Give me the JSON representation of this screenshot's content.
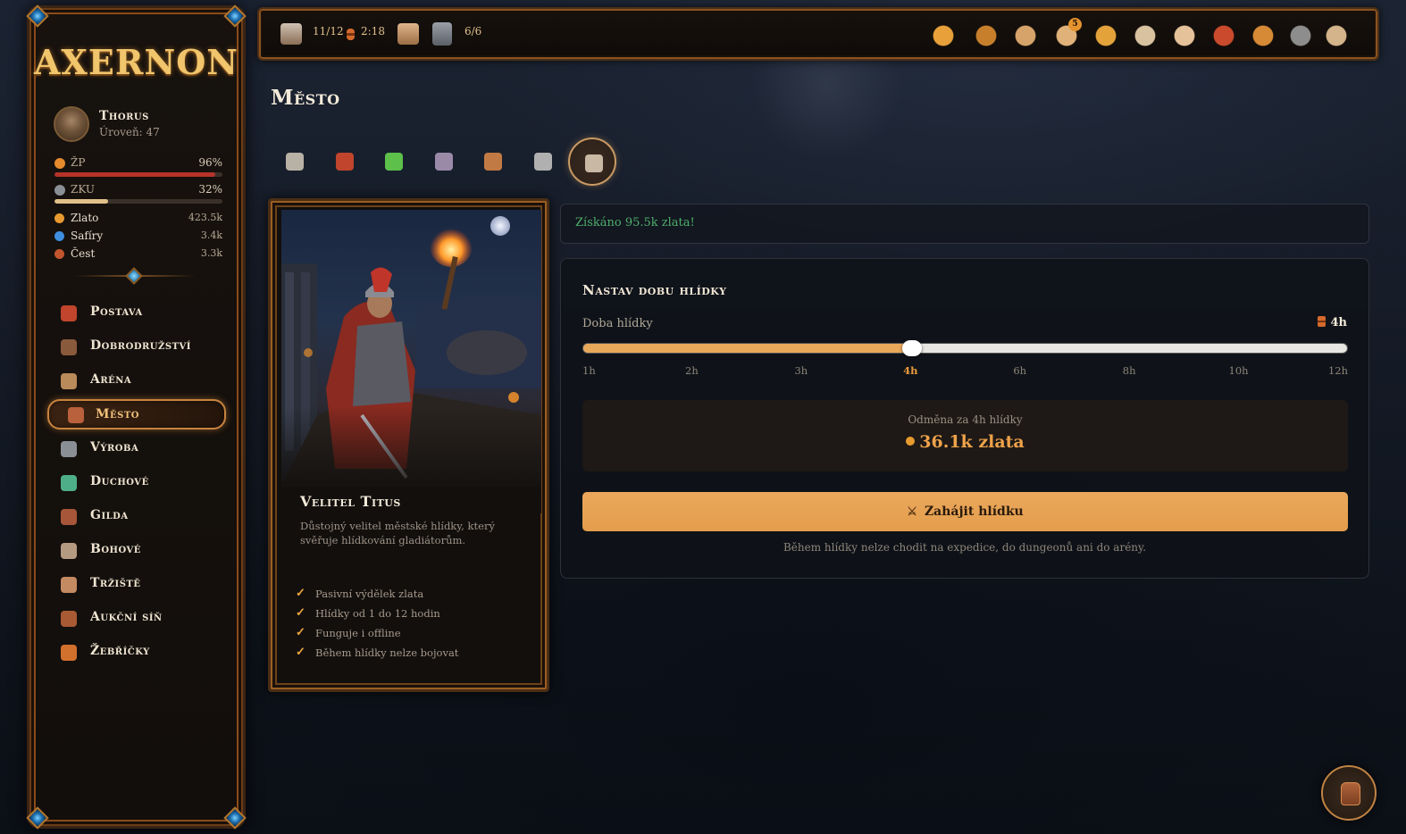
{
  "app": {
    "logo": "AXERNON"
  },
  "player": {
    "name": "Thorus",
    "level_label": "Úroveň: 47"
  },
  "stats": {
    "hp": {
      "label": "ŽP",
      "value": "96%",
      "percent": 96,
      "color": "#b6332a"
    },
    "xp": {
      "label": "ZKU",
      "value": "32%",
      "percent": 32,
      "color": "#e2c08a"
    }
  },
  "resources": [
    {
      "label": "Zlato",
      "value": "423.5k",
      "icon": "gold-coin-icon",
      "color": "#e79a2f"
    },
    {
      "label": "Safíry",
      "value": "3.4k",
      "icon": "sapphire-icon",
      "color": "#3f8ee0"
    },
    {
      "label": "Čest",
      "value": "3.3k",
      "icon": "honor-icon",
      "color": "#c2552d"
    }
  ],
  "nav": [
    {
      "label": "Postava",
      "icon": "helmet-icon",
      "color": "#c0452c",
      "active": false
    },
    {
      "label": "Dobrodružství",
      "icon": "adventurer-icon",
      "color": "#8a5a3c",
      "active": false
    },
    {
      "label": "Aréna",
      "icon": "arena-icon",
      "color": "#b98a5a",
      "active": false
    },
    {
      "label": "Město",
      "icon": "city-icon",
      "color": "#b9603c",
      "active": true
    },
    {
      "label": "Výroba",
      "icon": "hammer-icon",
      "color": "#8a8f96",
      "active": false
    },
    {
      "label": "Duchové",
      "icon": "ghost-icon",
      "color": "#4fae8a",
      "active": false
    },
    {
      "label": "Gilda",
      "icon": "guild-shield-icon",
      "color": "#a8563a",
      "active": false
    },
    {
      "label": "Bohové",
      "icon": "god-statue-icon",
      "color": "#b59a82",
      "active": false
    },
    {
      "label": "Tržiště",
      "icon": "market-icon",
      "color": "#c48a62",
      "active": false
    },
    {
      "label": "Aukční síň",
      "icon": "auction-icon",
      "color": "#a85a34",
      "active": false
    },
    {
      "label": "Žebříčky",
      "icon": "laurel-icon",
      "color": "#d2702e",
      "active": false
    }
  ],
  "topbar": {
    "expeditions": {
      "icon": "boot-icon",
      "value": "11/12"
    },
    "timer": {
      "icon": "hourglass-icon",
      "value": "2:18"
    },
    "arena_icon": "colosseum-icon",
    "dungeon": {
      "icon": "tower-icon",
      "value": "6/6"
    },
    "right_icons": [
      {
        "name": "crown-icon",
        "color": "#e8a13a"
      },
      {
        "name": "wheel-icon",
        "color": "#c87f2c"
      },
      {
        "name": "treasure-map-icon",
        "color": "#d6a46a"
      },
      {
        "name": "quest-scroll-icon",
        "color": "#e0b27a",
        "badge": "5"
      },
      {
        "name": "trophy-icon",
        "color": "#e3a23a"
      },
      {
        "name": "scroll-icon",
        "color": "#d8c2a0"
      },
      {
        "name": "mail-icon",
        "color": "#e6c29a"
      },
      {
        "name": "medal-icon",
        "color": "#c94a2c"
      },
      {
        "name": "help-icon",
        "color": "#d68a36"
      },
      {
        "name": "gear-icon",
        "color": "#8d8d8d"
      },
      {
        "name": "temple-icon",
        "color": "#d4b48a"
      }
    ]
  },
  "page": {
    "title": "Město"
  },
  "city_tabs": [
    {
      "name": "tab-blacksmith",
      "icon": "sword-icon",
      "color": "#b8b2a6",
      "active": false
    },
    {
      "name": "tab-armorer",
      "icon": "helmet-icon",
      "color": "#c0452c",
      "active": false
    },
    {
      "name": "tab-alchemist",
      "icon": "potion-icon",
      "color": "#5cc04a",
      "active": false
    },
    {
      "name": "tab-magic",
      "icon": "orb-icon",
      "color": "#9a8aa8",
      "active": false
    },
    {
      "name": "tab-market",
      "icon": "market-stall-icon",
      "color": "#c27a44",
      "active": false
    },
    {
      "name": "tab-training",
      "icon": "crossed-swords-icon",
      "color": "#b0b0b0",
      "active": false
    },
    {
      "name": "tab-watch",
      "icon": "watchtower-icon",
      "color": "#c8b8a4",
      "active": true
    }
  ],
  "npc": {
    "name": "Velitel Titus",
    "description": "Důstojný velitel městské hlídky, který svěřuje hlídkování gladiátorům.",
    "features": [
      "Pasivní výdělek zlata",
      "Hlídky od 1 do 12 hodin",
      "Funguje i offline",
      "Během hlídky nelze bojovat"
    ]
  },
  "alert": {
    "text": "Získáno 95.5k zlata!"
  },
  "watch": {
    "title": "Nastav dobu hlídky",
    "duration_label": "Doba hlídky",
    "duration_value": "4h",
    "slider_fraction": 0.43,
    "ticks": [
      "1h",
      "2h",
      "3h",
      "4h",
      "6h",
      "8h",
      "10h",
      "12h"
    ],
    "active_tick": 3,
    "reward_label": "Odměna za 4h hlídky",
    "reward_amount": "36.1k zlata",
    "start_button": "Zahájit hlídku",
    "note": "Během hlídky nelze chodit na expedice, do dungeonů ani do arény."
  },
  "inventory_button": {
    "icon": "backpack-icon"
  }
}
